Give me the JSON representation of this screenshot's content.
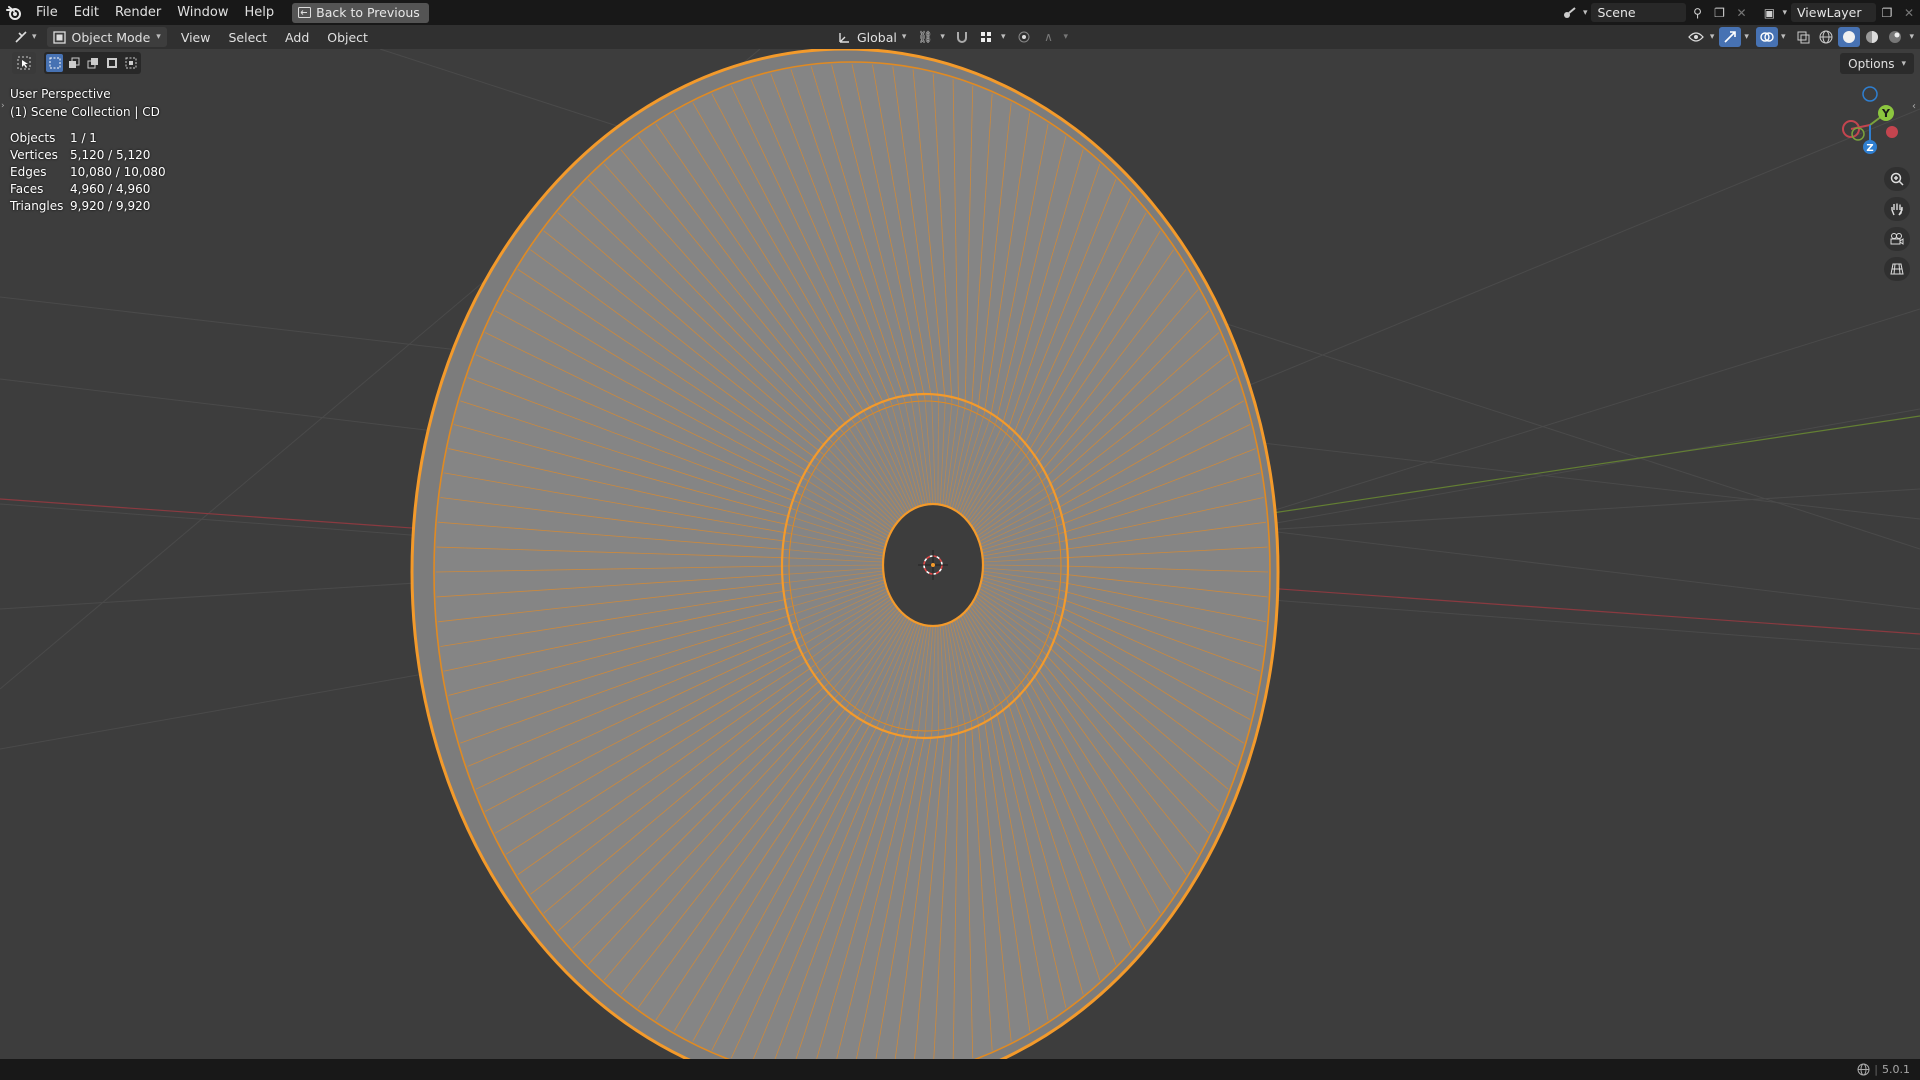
{
  "menubar": {
    "items": [
      "File",
      "Edit",
      "Render",
      "Window",
      "Help"
    ],
    "back_button": "Back to Previous"
  },
  "topright": {
    "scene": "Scene",
    "view_layer": "ViewLayer"
  },
  "header": {
    "mode": "Object Mode",
    "menus": [
      "View",
      "Select",
      "Add",
      "Object"
    ],
    "orientation": "Global",
    "options": "Options"
  },
  "viewport": {
    "view_name": "User Perspective",
    "collection": "(1) Scene Collection | CD"
  },
  "stats": [
    {
      "label": "Objects",
      "value": "1 / 1"
    },
    {
      "label": "Vertices",
      "value": "5,120 / 5,120"
    },
    {
      "label": "Edges",
      "value": "10,080 / 10,080"
    },
    {
      "label": "Faces",
      "value": "4,960 / 4,960"
    },
    {
      "label": "Triangles",
      "value": "9,920 / 9,920"
    }
  ],
  "gizmo": {
    "y_label": "Y",
    "z_label": "Z"
  },
  "status": {
    "version": "5.0.1"
  },
  "colors": {
    "selection_orange": "#f39a2b",
    "mesh_gray": "#8a8a8a",
    "axis_red": "#c4454f",
    "axis_green": "#7aa23c",
    "accent_blue": "#4772b3"
  }
}
